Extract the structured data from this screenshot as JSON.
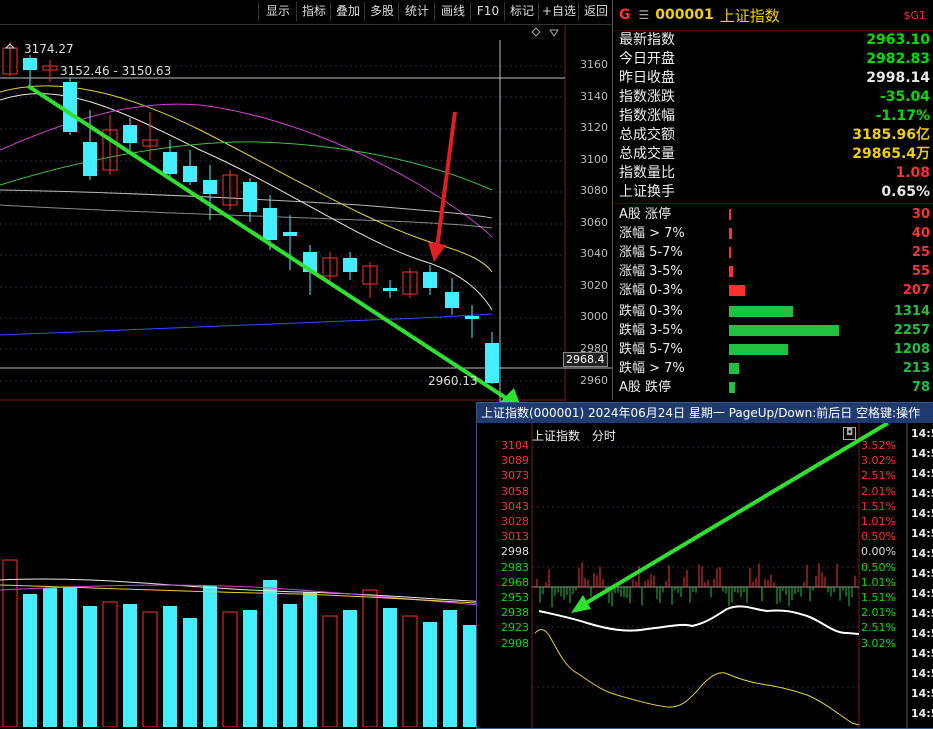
{
  "toolbar": {
    "buttons": [
      "显示",
      "指标",
      "叠加",
      "多股",
      "统计",
      "画线",
      "F10",
      "标记",
      "+自选",
      "返回"
    ]
  },
  "kline": {
    "high_label": "3174.27",
    "ma_label": "3152.46 - 3150.63",
    "low_label": "2960.13",
    "cursor_price": "2968.4",
    "y_ticks": [
      "3160",
      "3140",
      "3120",
      "3100",
      "3080",
      "3060",
      "3040",
      "3020",
      "3000",
      "2980",
      "2960"
    ]
  },
  "quote": {
    "g_label": "G",
    "code": "000001",
    "name": "上证指数",
    "badge": "$G1",
    "rows": [
      {
        "label": "最新指数",
        "value": "2963.10",
        "color": "#00e000"
      },
      {
        "label": "今日开盘",
        "value": "2982.83",
        "color": "#00e000"
      },
      {
        "label": "昨日收盘",
        "value": "2998.14",
        "color": "#e8e8e8"
      },
      {
        "label": "指数涨跌",
        "value": "-35.04",
        "color": "#00e000"
      },
      {
        "label": "指数涨幅",
        "value": "-1.17%",
        "color": "#00e000"
      },
      {
        "label": "总成交额",
        "value": "3185.96亿",
        "color": "#f0d000"
      },
      {
        "label": "总成交量",
        "value": "29865.4万",
        "color": "#f0d000"
      },
      {
        "label": "指数量比",
        "value": "1.08",
        "color": "#ff3030"
      },
      {
        "label": "上证换手",
        "value": "0.65%",
        "color": "#e8e8e8"
      }
    ]
  },
  "distribution": {
    "up": [
      {
        "label": "A股 涨停",
        "value": "30",
        "count": 30
      },
      {
        "label": "涨幅 > 7%",
        "value": "40",
        "count": 40
      },
      {
        "label": "涨幅 5-7%",
        "value": "25",
        "count": 25
      },
      {
        "label": "涨幅 3-5%",
        "value": "55",
        "count": 55
      },
      {
        "label": "涨幅 0-3%",
        "value": "207",
        "count": 207
      }
    ],
    "down": [
      {
        "label": "跌幅 0-3%",
        "value": "1314",
        "count": 1314
      },
      {
        "label": "跌幅 3-5%",
        "value": "2257",
        "count": 2257
      },
      {
        "label": "跌幅 5-7%",
        "value": "1208",
        "count": 1208
      },
      {
        "label": "跌幅 > 7%",
        "value": "213",
        "count": 213
      },
      {
        "label": "A股 跌停",
        "value": "78",
        "count": 78
      }
    ],
    "up_color": "#ff3030",
    "down_color": "#20c040"
  },
  "popup": {
    "title": "上证指数(000001) 2024年06月24日 星期一 PageUp/Down:前后日 空格键:操作",
    "subtitle_name": "上证指数",
    "subtitle_mode": "分时",
    "price_ticks": [
      "3104",
      "3089",
      "3073",
      "3058",
      "3043",
      "3028",
      "3013",
      "2998",
      "2983",
      "2968",
      "2953",
      "2938",
      "2923",
      "2908"
    ],
    "pct_ticks": [
      "3.52%",
      "3.02%",
      "2.51%",
      "2.01%",
      "1.51%",
      "1.01%",
      "0.50%",
      "0.00%",
      "0.50%",
      "1.01%",
      "1.51%",
      "2.01%",
      "2.51%",
      "3.02%"
    ],
    "time_ticks": [
      "14:5",
      "14:5",
      "14:5",
      "14:5",
      "14:5",
      "14:5",
      "14:5",
      "14:5",
      "14:5",
      "14:5",
      "14:5",
      "14:5",
      "14:5",
      "14:5",
      "14:5"
    ]
  }
}
